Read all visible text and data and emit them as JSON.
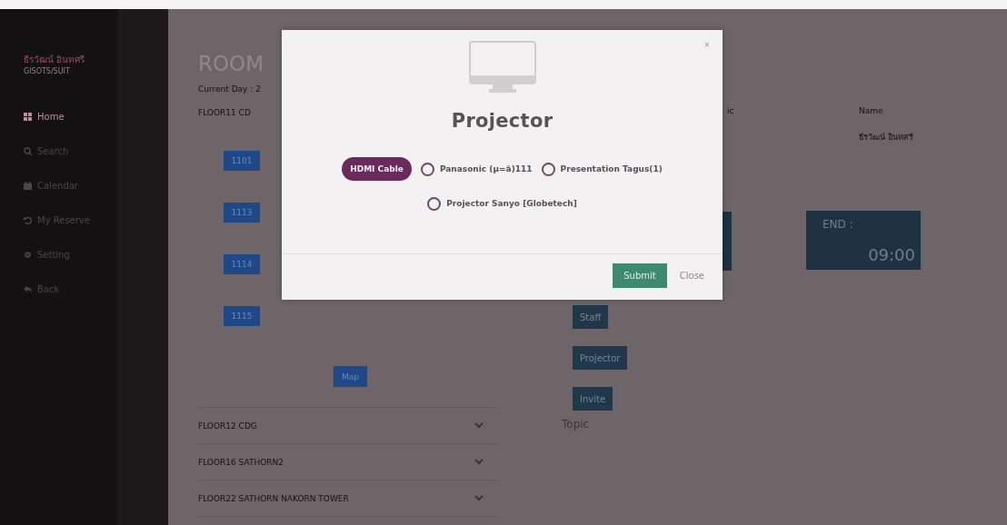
{
  "sidebar": {
    "user_name": "ธีรวัฒน์ อินทศรี",
    "user_group": "GISOTS/SUIT",
    "items": [
      {
        "label": "Home",
        "selected": true
      },
      {
        "label": "Search",
        "selected": false
      },
      {
        "label": "Calendar",
        "selected": false
      },
      {
        "label": "My Reserve",
        "selected": false
      },
      {
        "label": "Setting",
        "selected": false
      },
      {
        "label": "Back",
        "selected": false
      }
    ]
  },
  "page": {
    "title": "ROOM",
    "current_day": "Current Day : 2",
    "floors": [
      {
        "label": "FLOOR11 CD",
        "expanded": true,
        "rooms": [
          "1101",
          "1113",
          "1114",
          "1115"
        ]
      },
      {
        "label": "FLOOR12 CDG",
        "expanded": false
      },
      {
        "label": "FLOOR16 SATHORN2",
        "expanded": false
      },
      {
        "label": "FLOOR22 SATHORN NAKORN TOWER",
        "expanded": false
      }
    ],
    "map_button": "Map",
    "topic_header": "ic",
    "name_header": "Name",
    "name_value": "ธีรวัฒน์ อินทศรี",
    "end_label": "END :",
    "end_time": "09:00",
    "actions": [
      "Staff",
      "Projector",
      "Invite"
    ],
    "topic_label": "Topic"
  },
  "modal": {
    "title": "Projector",
    "close_glyph": "×",
    "options": [
      {
        "label": "HDMI Cable",
        "selected": true
      },
      {
        "label": "Panasonic (µ=â)111",
        "selected": false
      },
      {
        "label": "Presentation Tagus(1)",
        "selected": false
      },
      {
        "label": "Projector Sanyo [Globetech]",
        "selected": false
      }
    ],
    "buttons": [
      {
        "label": "Submit",
        "kind": "primary"
      },
      {
        "label": "Close",
        "kind": "link"
      }
    ]
  }
}
